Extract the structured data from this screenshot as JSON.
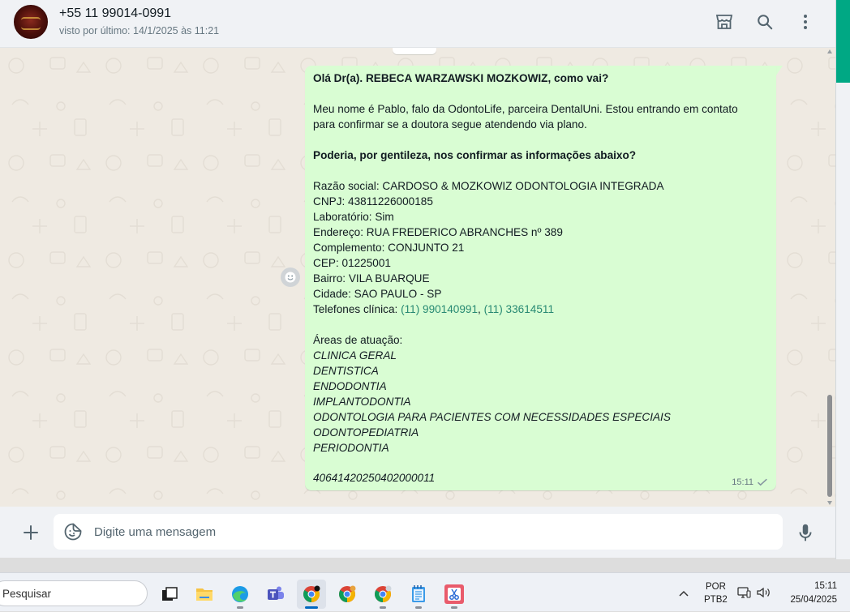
{
  "header": {
    "contact_name": "+55 11 99014-0991",
    "last_seen": "visto por último: 14/1/2025 às 11:21",
    "icons": [
      "store-icon",
      "search-icon",
      "menu-icon"
    ]
  },
  "message": {
    "greeting": "Olá Dr(a). REBECA WARZAWSKI MOZKOWIZ, como vai?",
    "intro_line1": "Meu nome é Pablo, falo da OdontoLife, parceira DentalUni. Estou entrando em contato",
    "intro_line2": "para confirmar se a doutora segue atendendo via plano.",
    "request": "Poderia, por gentileza, nos confirmar as informações abaixo?",
    "razao_social": "Razão social: CARDOSO & MOZKOWIZ ODONTOLOGIA INTEGRADA",
    "cnpj": "CNPJ: 43811226000185",
    "laboratorio": "Laboratório: Sim",
    "endereco": "Endereço: RUA FREDERICO ABRANCHES nº 389",
    "complemento": "Complemento: CONJUNTO 21",
    "cep": "CEP: 01225001",
    "bairro": "Bairro: VILA BUARQUE",
    "cidade": "Cidade: SAO PAULO - SP",
    "telefones_label": "Telefones clínica: ",
    "phone1": "(11) 990140991",
    "phone_sep": ", ",
    "phone2": "(11) 33614511",
    "areas_label": "Áreas de atuação:",
    "areas": [
      "CLINICA GERAL",
      "DENTISTICA",
      "ENDODONTIA",
      "IMPLANTODONTIA",
      "ODONTOLOGIA PARA PACIENTES COM NECESSIDADES ESPECIAIS",
      "ODONTOPEDIATRIA",
      "PERIODONTIA"
    ],
    "code": "40641420250402000011",
    "time": "15:11",
    "status_icon": "single-check-icon"
  },
  "composer": {
    "placeholder": "Digite uma mensagem"
  },
  "taskbar": {
    "search_placeholder": "Pesquisar",
    "language_line1": "POR",
    "language_line2": "PTB2",
    "clock_time": "15:11",
    "clock_date": "25/04/2025"
  },
  "colors": {
    "bubble_out": "#d9fdd3",
    "chat_bg": "#efeae2",
    "accent": "#00a884",
    "link": "#288a73"
  }
}
